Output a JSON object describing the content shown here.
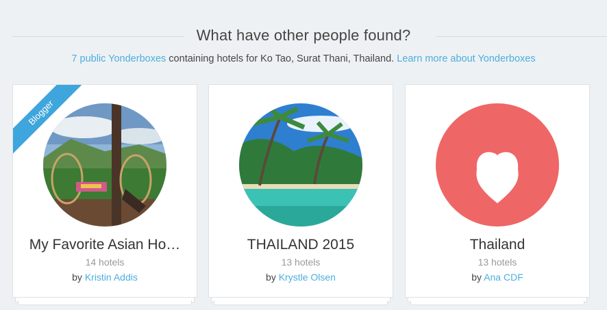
{
  "heading": "What have other people found?",
  "subline": {
    "link_count": "7 public Yonderboxes",
    "text": " containing hotels for Ko Tao, Surat Thani, Thailand. ",
    "learn_more": "Learn more about Yonderboxes"
  },
  "colors": {
    "accent": "#4aaee0",
    "ribbon": "#3ea6dc",
    "heart_bg": "#ee6666"
  },
  "cards": [
    {
      "title": "My Favorite Asian Ho…",
      "count": "14 hotels",
      "by": "by",
      "author": "Kristin Addis",
      "badge": "Blogger"
    },
    {
      "title": "THAILAND 2015",
      "count": "13 hotels",
      "by": "by",
      "author": "Krystle Olsen"
    },
    {
      "title": "Thailand",
      "count": "13 hotels",
      "by": "by",
      "author": "Ana CDF",
      "icon": "heart-icon"
    }
  ]
}
